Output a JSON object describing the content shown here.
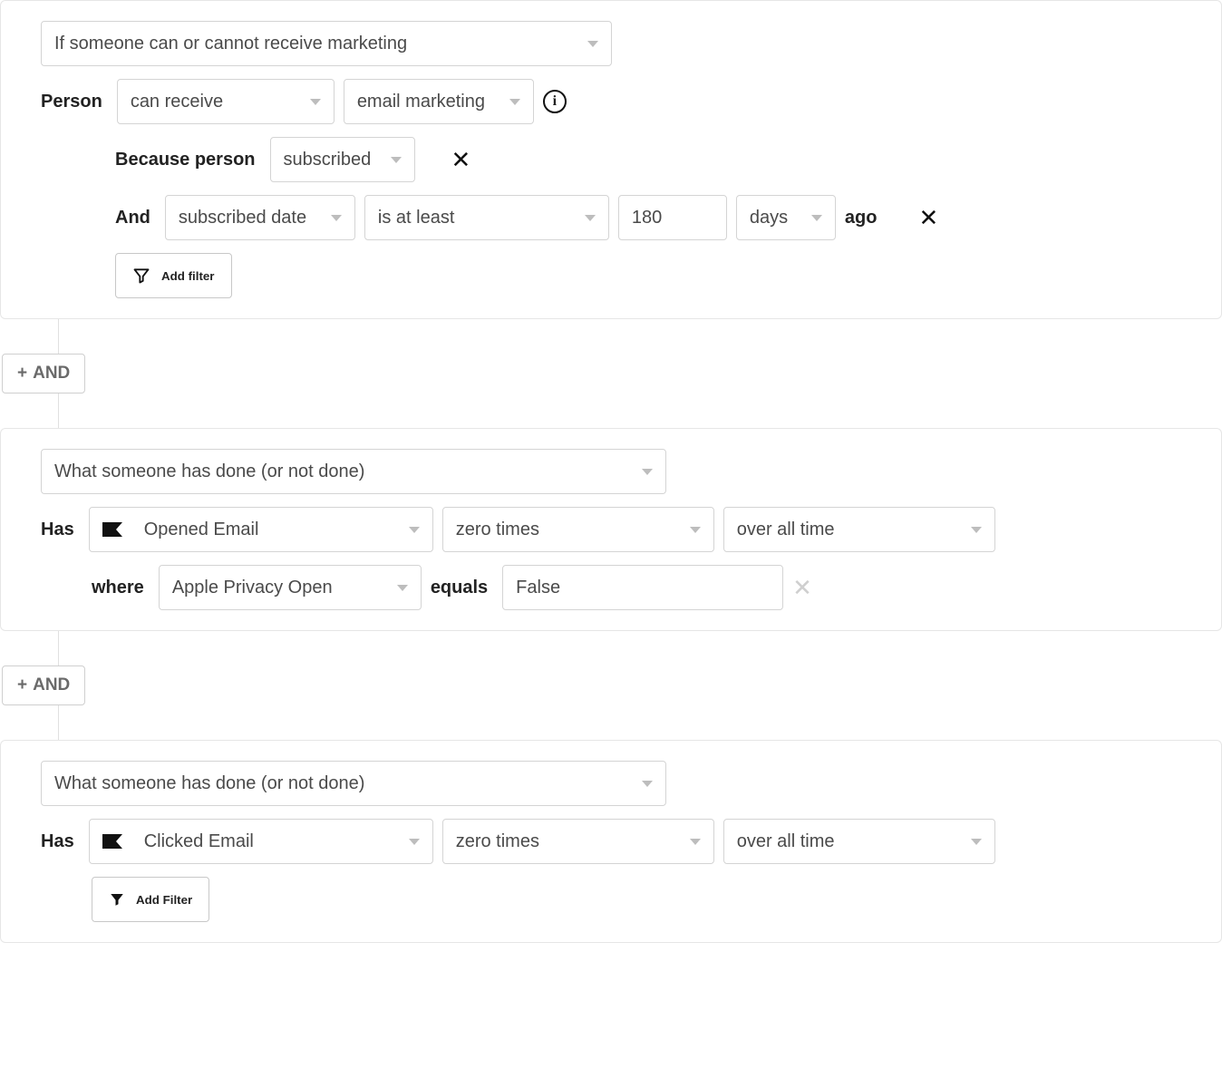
{
  "block1": {
    "condition_type": "If someone can or cannot receive marketing",
    "person_label": "Person",
    "can_receive": "can receive",
    "channel": "email marketing",
    "because_label": "Because person",
    "because_value": "subscribed",
    "and_label": "And",
    "date_field": "subscribed date",
    "comparator": "is at least",
    "value": "180",
    "unit": "days",
    "ago_label": "ago",
    "add_filter_label": "Add filter"
  },
  "connector": {
    "and_label": "AND"
  },
  "block2": {
    "condition_type": "What someone has done (or not done)",
    "has_label": "Has",
    "metric": "Opened Email",
    "times": "zero times",
    "timeframe": "over all time",
    "where_label": "where",
    "where_field": "Apple Privacy Open",
    "equals_label": "equals",
    "where_value": "False"
  },
  "block3": {
    "condition_type": "What someone has done (or not done)",
    "has_label": "Has",
    "metric": "Clicked Email",
    "times": "zero times",
    "timeframe": "over all time",
    "add_filter_label": "Add Filter"
  }
}
